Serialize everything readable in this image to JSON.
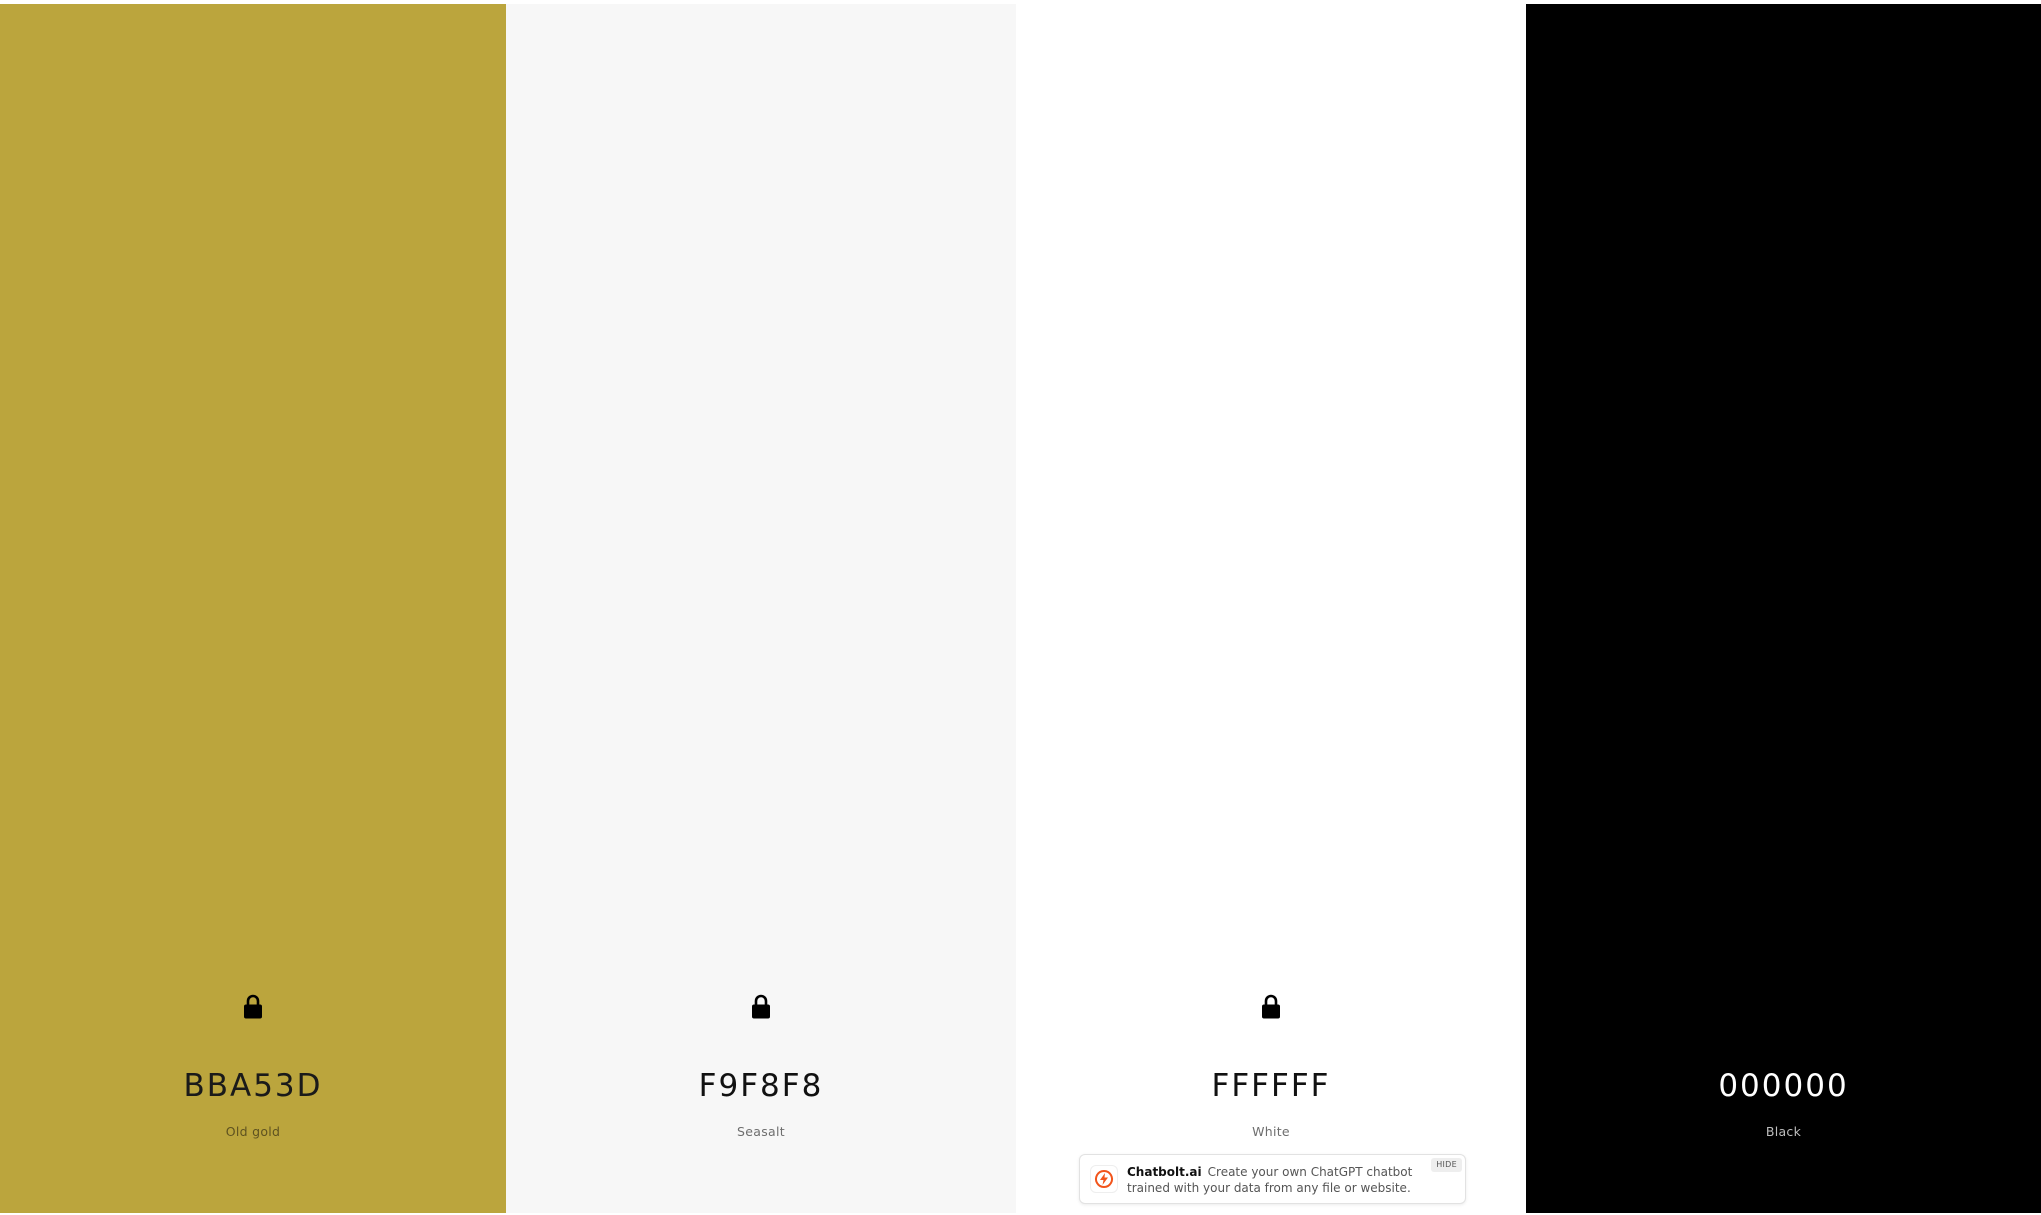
{
  "palette": {
    "colors": [
      {
        "hex": "BBA53D",
        "name": "Old gold",
        "background": "#BBA53D",
        "text_color": "#1a1a1a",
        "name_color": "#5e5220",
        "locked": true
      },
      {
        "hex": "F9F8F8",
        "name": "Seasalt",
        "background": "#F7F7F7",
        "text_color": "#111111",
        "name_color": "#6e6e6e",
        "locked": true
      },
      {
        "hex": "FFFFFF",
        "name": "White",
        "background": "#FFFFFF",
        "text_color": "#111111",
        "name_color": "#6e6e6e",
        "locked": true
      },
      {
        "hex": "000000",
        "name": "Black",
        "background": "#000000",
        "text_color": "#ffffff",
        "name_color": "#bdbdbd",
        "locked": false
      }
    ],
    "lock_icon": "lock-icon"
  },
  "ad": {
    "brand": "Chatbolt.ai",
    "text": "Create your own ChatGPT chatbot trained with your data from any file or website.",
    "hide_label": "HIDE",
    "logo_icon": "bolt-chat-icon",
    "accent_color": "#F2541B"
  }
}
